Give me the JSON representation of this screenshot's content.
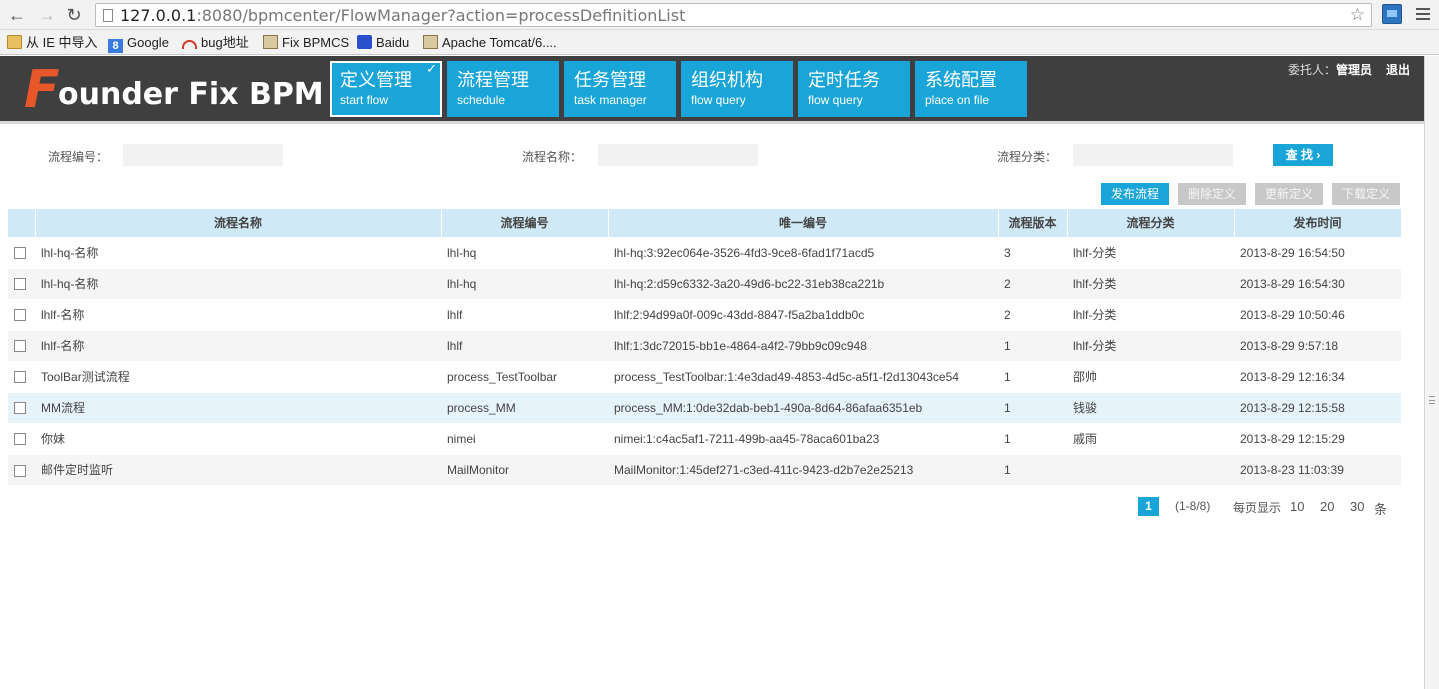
{
  "browser": {
    "url_host": "127.0.0.1",
    "url_rest": ":8080/bpmcenter/FlowManager?action=processDefinitionList",
    "bookmarks": [
      {
        "label": "从 IE 中导入",
        "icon": "folder-icon"
      },
      {
        "label": "Google",
        "icon": "google-icon"
      },
      {
        "label": "bug地址",
        "icon": "bug-icon"
      },
      {
        "label": "Fix BPMCS",
        "icon": "page-icon"
      },
      {
        "label": "Baidu",
        "icon": "baidu-icon"
      },
      {
        "label": "Apache Tomcat/6....",
        "icon": "page-icon"
      }
    ]
  },
  "header": {
    "logo_initial": "F",
    "logo_rest": "ounder Fix BPM",
    "tabs": [
      {
        "zh": "定义管理",
        "en": "start flow"
      },
      {
        "zh": "流程管理",
        "en": "schedule"
      },
      {
        "zh": "任务管理",
        "en": "task manager"
      },
      {
        "zh": "组织机构",
        "en": "flow query"
      },
      {
        "zh": "定时任务",
        "en": "flow query"
      },
      {
        "zh": "系统配置",
        "en": "place on file"
      }
    ],
    "delegate_label": "委托人：",
    "delegate_name": "管理员",
    "logout": "退出"
  },
  "search": {
    "code_label": "流程编号：",
    "name_label": "流程名称：",
    "category_label": "流程分类：",
    "code_value": "",
    "name_value": "",
    "category_value": "",
    "find_button": "查 找 ›"
  },
  "actions": {
    "publish": "发布流程",
    "delete": "删除定义",
    "update": "更新定义",
    "download": "下载定义"
  },
  "table": {
    "headers": [
      "流程名称",
      "流程编号",
      "唯一编号",
      "流程版本",
      "流程分类",
      "发布时间"
    ],
    "rows": [
      [
        "lhl-hq-名称",
        "lhl-hq",
        "lhl-hq:3:92ec064e-3526-4fd3-9ce8-6fad1f71acd5",
        "3",
        "lhlf-分类",
        "2013-8-29 16:54:50"
      ],
      [
        "lhl-hq-名称",
        "lhl-hq",
        "lhl-hq:2:d59c6332-3a20-49d6-bc22-31eb38ca221b",
        "2",
        "lhlf-分类",
        "2013-8-29 16:54:30"
      ],
      [
        "lhlf-名称",
        "lhlf",
        "lhlf:2:94d99a0f-009c-43dd-8847-f5a2ba1ddb0c",
        "2",
        "lhlf-分类",
        "2013-8-29 10:50:46"
      ],
      [
        "lhlf-名称",
        "lhlf",
        "lhlf:1:3dc72015-bb1e-4864-a4f2-79bb9c09c948",
        "1",
        "lhlf-分类",
        "2013-8-29 9:57:18"
      ],
      [
        "ToolBar测试流程",
        "process_TestToolbar",
        "process_TestToolbar:1:4e3dad49-4853-4d5c-a5f1-f2d13043ce54",
        "1",
        "邵帅",
        "2013-8-29 12:16:34"
      ],
      [
        "MM流程",
        "process_MM",
        "process_MM:1:0de32dab-beb1-490a-8d64-86afaa6351eb",
        "1",
        "钱骏",
        "2013-8-29 12:15:58"
      ],
      [
        "你妹",
        "nimei",
        "nimei:1:c4ac5af1-7211-499b-aa45-78aca601ba23",
        "1",
        "戚雨",
        "2013-8-29 12:15:29"
      ],
      [
        "邮件定时监听",
        "MailMonitor",
        "MailMonitor:1:45def271-c3ed-411c-9423-d2b7e2e25213",
        "1",
        "",
        "2013-8-23 11:03:39"
      ]
    ]
  },
  "pager": {
    "current_page": "1",
    "range": "(1-8/8)",
    "per_page_label": "每页显示",
    "sizes": [
      "10",
      "20",
      "30"
    ],
    "unit": "条"
  }
}
